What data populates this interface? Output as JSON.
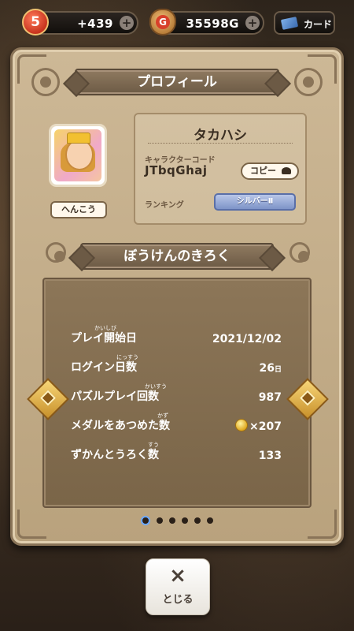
{
  "topbar": {
    "hearts": "5",
    "hearts_bonus": "+439",
    "gold": "35598G",
    "plus": "+",
    "card_label": "カード"
  },
  "profile": {
    "title": "プロフィール",
    "change_button": "へんこう",
    "name": "タカハシ",
    "code_label": "キャラクターコード",
    "code": "JTbqGhaj",
    "copy_button": "コピー",
    "rank_label": "ランキング",
    "rank": "シルバーⅡ"
  },
  "record": {
    "title": "ぼうけんのきろく",
    "rows": [
      {
        "label": "プレイ開始日",
        "ruby": "かいしび",
        "value": "2021/12/02",
        "unit": ""
      },
      {
        "label": "ログイン日数",
        "ruby": "にっすう",
        "value": "26",
        "unit": "日"
      },
      {
        "label": "パズルプレイ回数",
        "ruby": "かいすう",
        "value": "987",
        "unit": ""
      },
      {
        "label": "メダルをあつめた数",
        "ruby": "かず",
        "value": "×207",
        "unit": ""
      },
      {
        "label": "ずかんとうろく数",
        "ruby": "すう",
        "value": "133",
        "unit": ""
      }
    ]
  },
  "pagination": {
    "count": 6,
    "active": 0
  },
  "close_button": {
    "icon": "×",
    "label": "とじる"
  },
  "colors": {
    "panel": "#cdb896",
    "stats": "#8c7658",
    "accent_gold": "#f7d678"
  }
}
